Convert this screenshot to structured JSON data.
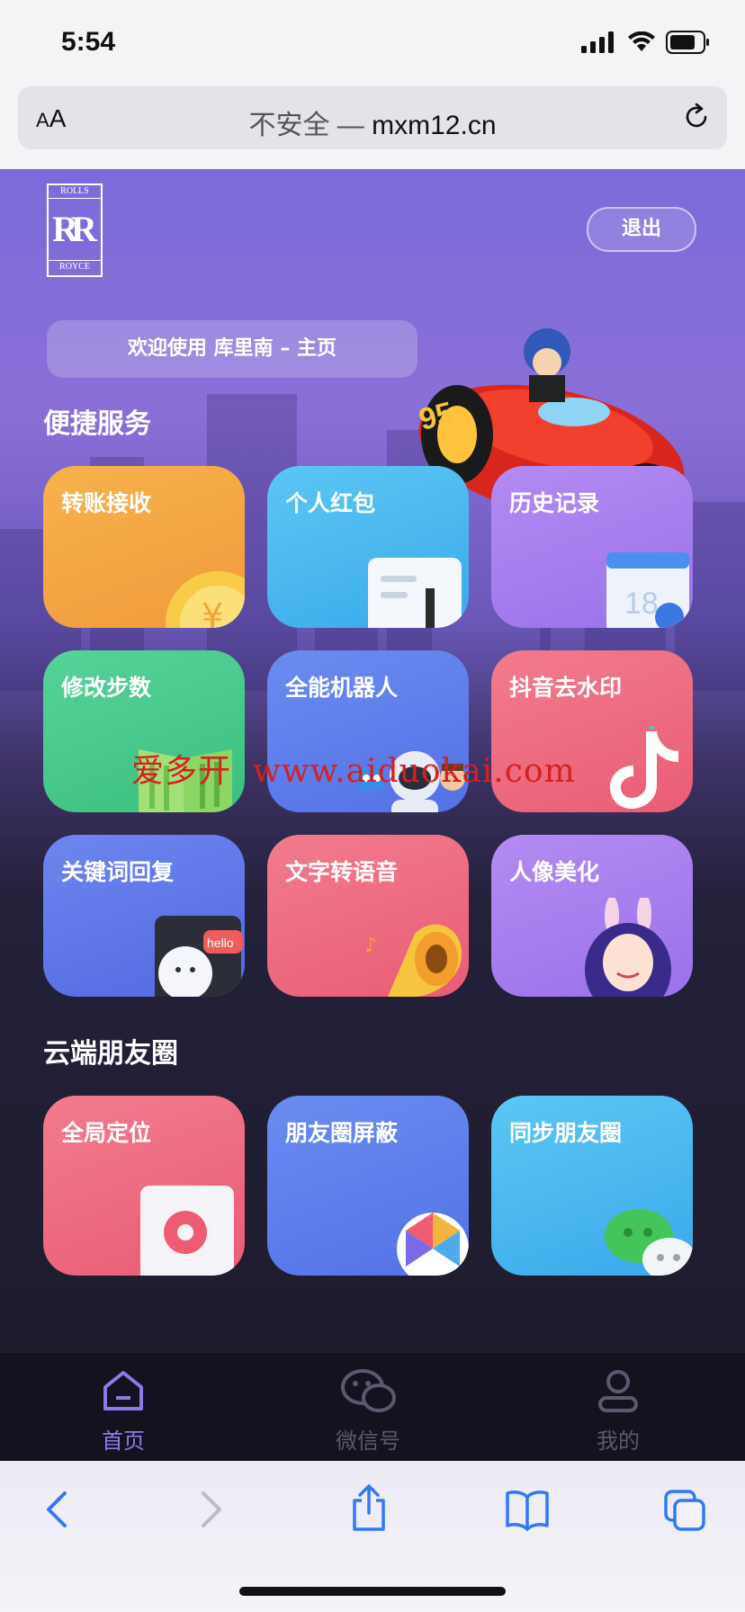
{
  "status_bar": {
    "time": "5:54"
  },
  "browser": {
    "aa_label_small": "A",
    "aa_label": "A",
    "security": "不安全 — ",
    "host": "mxm12.cn"
  },
  "header": {
    "logo_top": "ROLLS",
    "logo_mid": "RR",
    "logo_bottom": "ROYCE",
    "logout_label": "退出",
    "welcome_text": "欢迎使用 库里南 – 主页"
  },
  "sections": {
    "quick_services": {
      "title": "便捷服务",
      "cards": [
        {
          "label": "转账接收",
          "color_top": "#f7b24d",
          "color_bottom": "#f09a3c"
        },
        {
          "label": "个人红包",
          "color_top": "#5cc7f4",
          "color_bottom": "#3aa9ea"
        },
        {
          "label": "历史记录",
          "color_top": "#b48bf2",
          "color_bottom": "#9a72ea"
        },
        {
          "label": "修改步数",
          "color_top": "#55d39a",
          "color_bottom": "#3cbf7e"
        },
        {
          "label": "全能机器人",
          "color_top": "#6a8cf0",
          "color_bottom": "#5471e6"
        },
        {
          "label": "抖音去水印",
          "color_top": "#f27b8d",
          "color_bottom": "#e95d76"
        },
        {
          "label": "关键词回复",
          "color_top": "#6d86ef",
          "color_bottom": "#5369e2"
        },
        {
          "label": "文字转语音",
          "color_top": "#f27b8d",
          "color_bottom": "#e95d76"
        },
        {
          "label": "人像美化",
          "color_top": "#b48bf2",
          "color_bottom": "#9a72ea"
        }
      ]
    },
    "cloud_moments": {
      "title": "云端朋友圈",
      "cards": [
        {
          "label": "全局定位",
          "color_top": "#f27b8d",
          "color_bottom": "#e95d76"
        },
        {
          "label": "朋友圈屏蔽",
          "color_top": "#6a8cf0",
          "color_bottom": "#5471e6"
        },
        {
          "label": "同步朋友圈",
          "color_top": "#5cc7f4",
          "color_bottom": "#3aa9ea"
        }
      ]
    }
  },
  "watermark": {
    "cn": "爱多开",
    "url": "www.aiduokai.com"
  },
  "tabbar": {
    "items": [
      {
        "label": "首页",
        "icon": "home-icon",
        "active": true
      },
      {
        "label": "微信号",
        "icon": "wechat-icon",
        "active": false
      },
      {
        "label": "我的",
        "icon": "user-icon",
        "active": false
      }
    ],
    "active_color": "#8b7be8",
    "inactive_color": "#5b5870"
  }
}
